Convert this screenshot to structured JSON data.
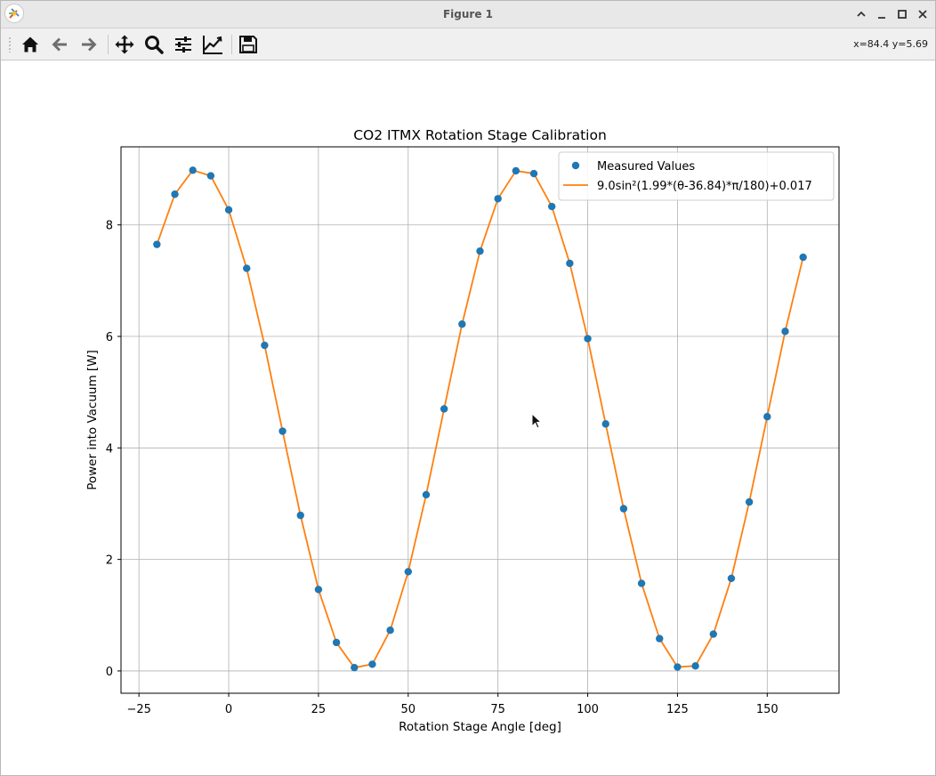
{
  "window": {
    "title": "Figure 1"
  },
  "toolbar": {
    "buttons": [
      {
        "name": "home",
        "icon": "home-icon"
      },
      {
        "name": "back",
        "icon": "arrow-left-icon"
      },
      {
        "name": "forward",
        "icon": "arrow-right-icon"
      },
      {
        "name": "pan",
        "icon": "move-icon"
      },
      {
        "name": "zoom",
        "icon": "magnifier-icon"
      },
      {
        "name": "subplots",
        "icon": "sliders-icon"
      },
      {
        "name": "customize",
        "icon": "line-chart-icon"
      },
      {
        "name": "save",
        "icon": "floppy-disk-icon"
      }
    ],
    "coords": "x=84.4 y=5.69"
  },
  "chart_data": {
    "type": "scatter",
    "title": "CO2 ITMX Rotation Stage Calibration",
    "xlabel": "Rotation Stage Angle [deg]",
    "ylabel": "Power into Vacuum [W]",
    "xlim": [
      -30,
      170
    ],
    "ylim": [
      -0.4,
      9.4
    ],
    "xticks": [
      -25,
      0,
      25,
      50,
      75,
      100,
      125,
      150
    ],
    "xtick_labels": [
      "−25",
      "0",
      "25",
      "50",
      "75",
      "100",
      "125",
      "150"
    ],
    "yticks": [
      0,
      2,
      4,
      6,
      8
    ],
    "ytick_labels": [
      "0",
      "2",
      "4",
      "6",
      "8"
    ],
    "grid": true,
    "legend_position": "upper right",
    "series": [
      {
        "name": "Measured Values",
        "kind": "scatter",
        "color": "#1f77b4",
        "x": [
          -20,
          -15,
          -10,
          -5,
          0,
          5,
          10,
          15,
          20,
          25,
          30,
          35,
          40,
          45,
          50,
          55,
          60,
          65,
          70,
          75,
          80,
          85,
          90,
          95,
          100,
          105,
          110,
          115,
          120,
          125,
          130,
          135,
          140,
          145,
          150,
          155,
          160
        ],
        "y": [
          7.65,
          8.55,
          8.98,
          8.88,
          8.27,
          7.22,
          5.84,
          4.3,
          2.79,
          1.46,
          0.51,
          0.06,
          0.12,
          0.73,
          1.78,
          3.16,
          4.7,
          6.22,
          7.53,
          8.47,
          8.97,
          8.92,
          8.33,
          7.31,
          5.96,
          4.43,
          2.91,
          1.57,
          0.58,
          0.07,
          0.09,
          0.66,
          1.66,
          3.03,
          4.56,
          6.09,
          7.42
        ]
      },
      {
        "name": "9.0sin²(1.99*(θ-36.84)*π/180)+0.017",
        "kind": "line",
        "color": "#ff7f0e",
        "x": [
          -20,
          -15,
          -10,
          -5,
          0,
          5,
          10,
          15,
          20,
          25,
          30,
          35,
          40,
          45,
          50,
          55,
          60,
          65,
          70,
          75,
          80,
          85,
          90,
          95,
          100,
          105,
          110,
          115,
          120,
          125,
          130,
          135,
          140,
          145,
          150,
          155,
          160
        ],
        "y": [
          7.65,
          8.55,
          8.98,
          8.88,
          8.27,
          7.22,
          5.84,
          4.3,
          2.79,
          1.46,
          0.51,
          0.06,
          0.12,
          0.73,
          1.78,
          3.16,
          4.7,
          6.22,
          7.53,
          8.47,
          8.97,
          8.92,
          8.33,
          7.31,
          5.96,
          4.43,
          2.91,
          1.57,
          0.58,
          0.07,
          0.09,
          0.66,
          1.66,
          3.03,
          4.56,
          6.09,
          7.42
        ]
      }
    ]
  }
}
